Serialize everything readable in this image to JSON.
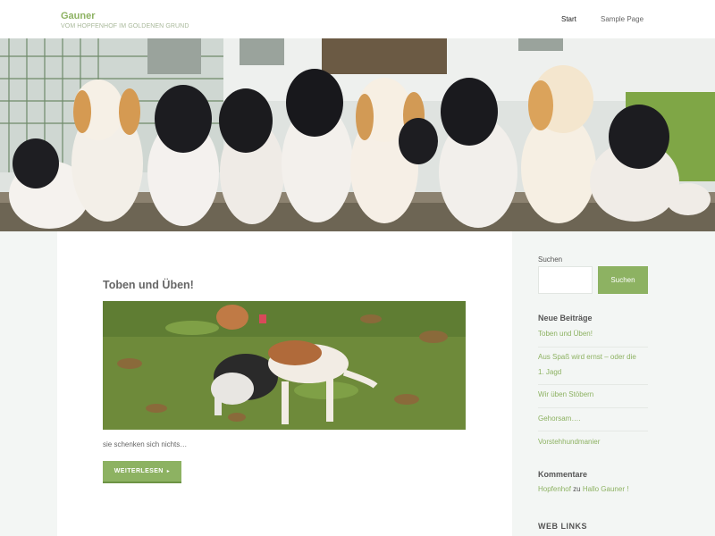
{
  "header": {
    "site_title": "Gauner",
    "tagline": "VOM HOPFENHOF IM GOLDENEN GRUND",
    "nav": [
      {
        "label": "Start"
      },
      {
        "label": "Sample Page"
      }
    ]
  },
  "post": {
    "title": "Toben und Üben!",
    "excerpt": "sie schenken sich nichts…",
    "read_more": "WEITERLESEN"
  },
  "sidebar": {
    "search_label": "Suchen",
    "search_button": "Suchen",
    "recent_posts_title": "Neue Beiträge",
    "recent_posts": [
      {
        "label": "Toben und Üben!"
      },
      {
        "label": "Aus Spaß wird ernst – oder die"
      },
      {
        "label": "1. Jagd"
      },
      {
        "label": "Wir üben Stöbern"
      },
      {
        "label": "Gehorsam…."
      },
      {
        "label": "Vorstehhundmanier"
      }
    ],
    "comments_title": "Kommentare",
    "comment": {
      "author": "Hopfenhof",
      "connector": "zu",
      "post": "Hallo Gauner !"
    },
    "weblinks_title": "WEB LINKS"
  },
  "colors": {
    "accent": "#8db262",
    "background": "#f3f6f4"
  },
  "icons": {
    "read_more_arrow": "caret-right-icon"
  }
}
